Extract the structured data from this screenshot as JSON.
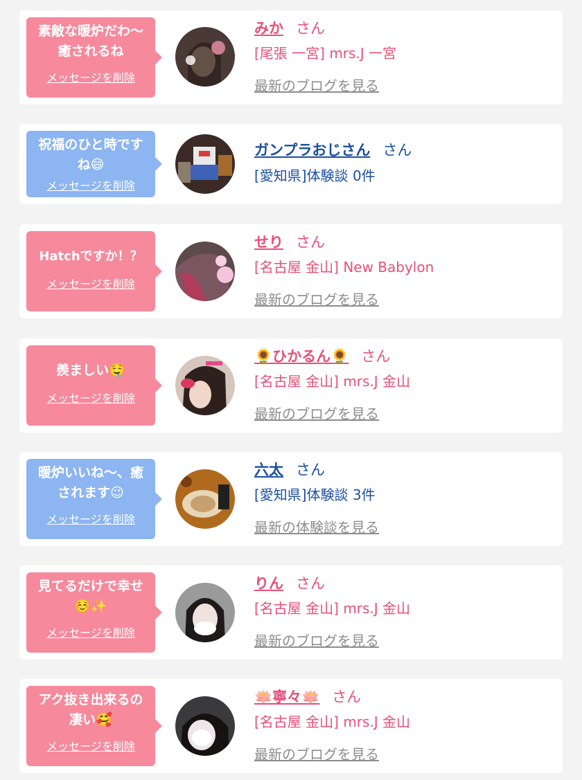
{
  "delete_label": "メッセージを削除",
  "san_label": "さん",
  "colors": {
    "pink": "#f6899c",
    "blue": "#8cb5f2",
    "pink_text": "#e84f78",
    "blue_text": "#1c4fa0"
  },
  "items": [
    {
      "message": "素敵な暖炉だわ〜\n癒されるね",
      "bubble_color": "pink",
      "name": "みか",
      "shop": "[尾張 一宮] mrs.J 一宮",
      "link": "最新のブログを見る"
    },
    {
      "message": "祝福のひと時です\nね😄",
      "bubble_color": "blue",
      "name": "ガンプラおじさん",
      "shop": "[愛知県]体験談 0件",
      "link": ""
    },
    {
      "message": "Hatchですか！？",
      "bubble_color": "pink",
      "name": "せり",
      "shop": "[名古屋 金山] New Babylon",
      "link": "最新のブログを見る"
    },
    {
      "message": "羨ましい🤤",
      "bubble_color": "pink",
      "name": "🌻ひかるん🌻",
      "shop": "[名古屋 金山] mrs.J 金山",
      "link": "最新のブログを見る"
    },
    {
      "message": "暖炉いいね〜、癒\nされます😉",
      "bubble_color": "blue",
      "name": "六太",
      "shop": "[愛知県]体験談 3件",
      "link": "最新の体験談を見る"
    },
    {
      "message": "見てるだけで幸せ\n☺️✨",
      "bubble_color": "pink",
      "name": "りん",
      "shop": "[名古屋 金山] mrs.J 金山",
      "link": "最新のブログを見る"
    },
    {
      "message": "アク抜き出来るの\n凄い🥰",
      "bubble_color": "pink",
      "name": "🪷寧々🪷",
      "shop": "[名古屋 金山] mrs.J 金山",
      "link": "最新のブログを見る"
    }
  ]
}
